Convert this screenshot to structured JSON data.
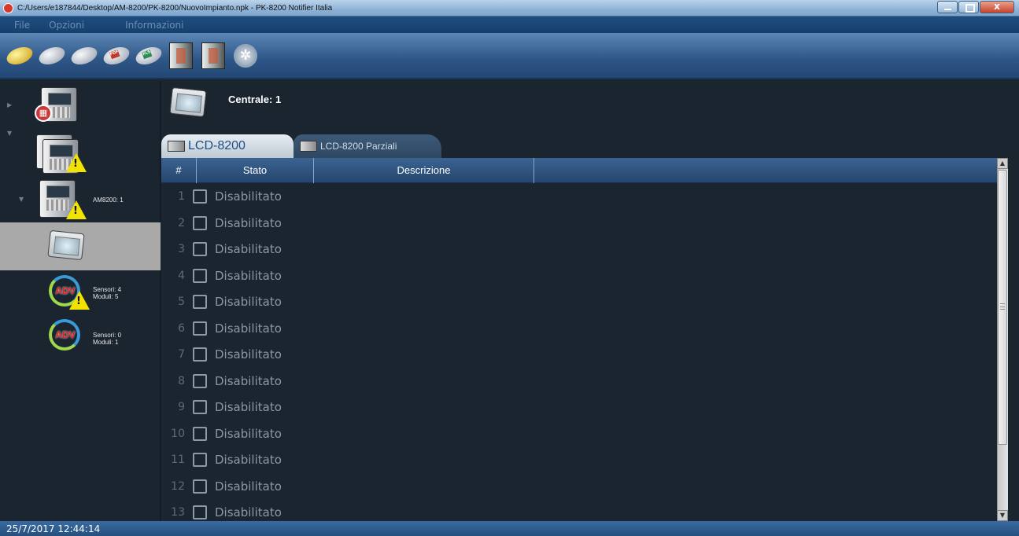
{
  "window": {
    "title": "C:/Users/e187844/Desktop/AM-8200/PK-8200/NuovoImpianto.npk - PK-8200 Notifier Italia"
  },
  "menu": {
    "file": "File",
    "options": "Opzioni",
    "info": "Informazioni"
  },
  "toolbar": {
    "buttons": [
      {
        "icon": "open-file-icon"
      },
      {
        "icon": "search-file-icon"
      },
      {
        "icon": "save-file-icon"
      },
      {
        "icon": "pdf-export-icon",
        "badge": "PDF"
      },
      {
        "icon": "xls-export-icon",
        "badge": "XLS"
      },
      {
        "icon": "panel-receive-icon"
      },
      {
        "icon": "panel-send-icon"
      },
      {
        "icon": "settings-icon"
      }
    ]
  },
  "tree": {
    "panel_node": {
      "label": "AM8200: 1"
    },
    "adv1": {
      "badge": "ADV",
      "sensors": "Sensori: 4",
      "modules": "Moduli: 5"
    },
    "adv2": {
      "badge": "ADV",
      "sensors": "Sensori: 0",
      "modules": "Moduli: 1"
    }
  },
  "header": {
    "title": "Centrale: 1"
  },
  "tabs": [
    {
      "label": "LCD-8200"
    },
    {
      "label": "LCD-8200 Parziali"
    }
  ],
  "grid": {
    "columns": {
      "num": "#",
      "state": "Stato",
      "desc": "Descrizione"
    },
    "rows": [
      {
        "num": "1",
        "state": "Disabilitato"
      },
      {
        "num": "2",
        "state": "Disabilitato"
      },
      {
        "num": "3",
        "state": "Disabilitato"
      },
      {
        "num": "4",
        "state": "Disabilitato"
      },
      {
        "num": "5",
        "state": "Disabilitato"
      },
      {
        "num": "6",
        "state": "Disabilitato"
      },
      {
        "num": "7",
        "state": "Disabilitato"
      },
      {
        "num": "8",
        "state": "Disabilitato"
      },
      {
        "num": "9",
        "state": "Disabilitato"
      },
      {
        "num": "10",
        "state": "Disabilitato"
      },
      {
        "num": "11",
        "state": "Disabilitato"
      },
      {
        "num": "12",
        "state": "Disabilitato"
      },
      {
        "num": "13",
        "state": "Disabilitato"
      }
    ]
  },
  "status": {
    "datetime": "25/7/2017 12:44:14"
  }
}
